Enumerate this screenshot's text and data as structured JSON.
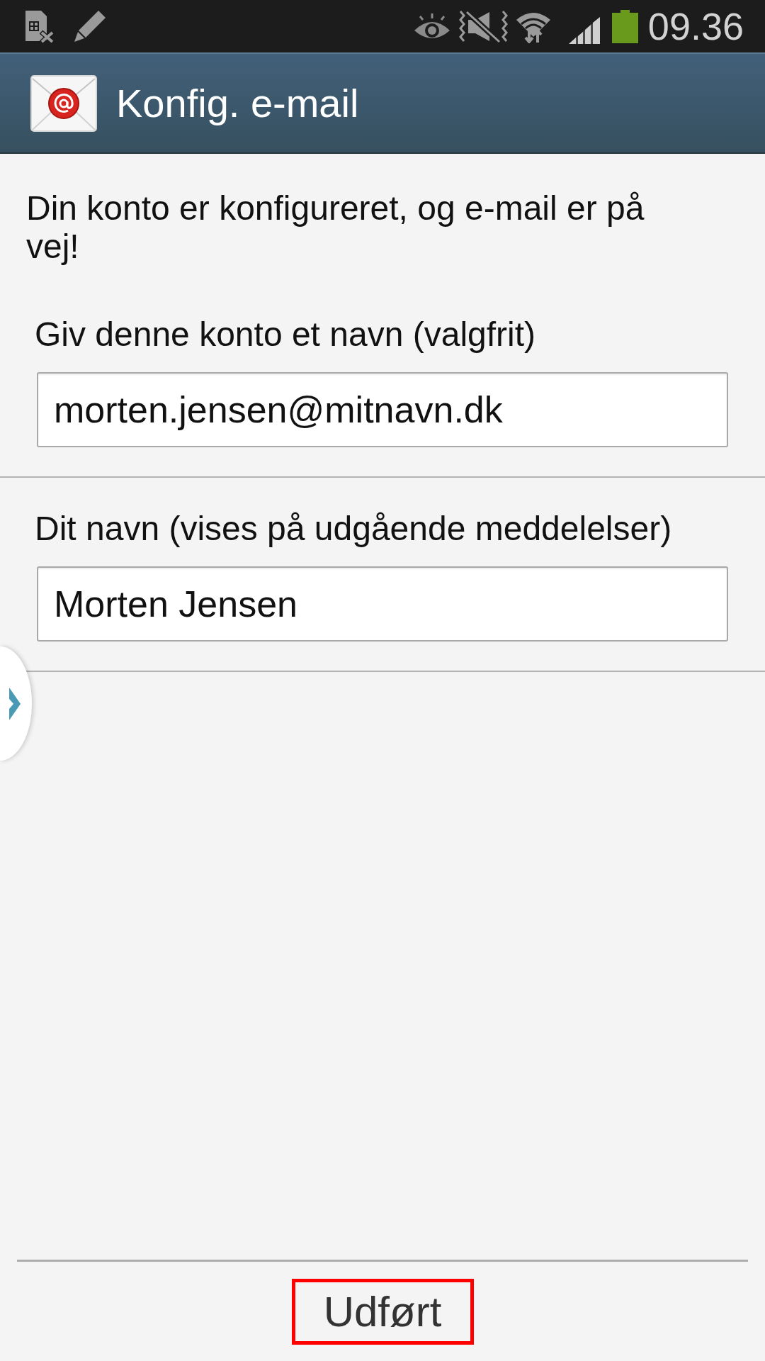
{
  "status_bar": {
    "time": "09.36"
  },
  "app_bar": {
    "title": "Konfig. e-mail"
  },
  "message": "Din konto er konfigureret, og e-mail er på vej!",
  "fields": [
    {
      "label": "Giv denne konto et navn (valgfrit)",
      "value": "morten.jensen@mitnavn.dk"
    },
    {
      "label": "Dit navn (vises på udgående meddelelser)",
      "value": "Morten Jensen"
    }
  ],
  "done_button": {
    "label": "Udført",
    "highlighted": true
  }
}
